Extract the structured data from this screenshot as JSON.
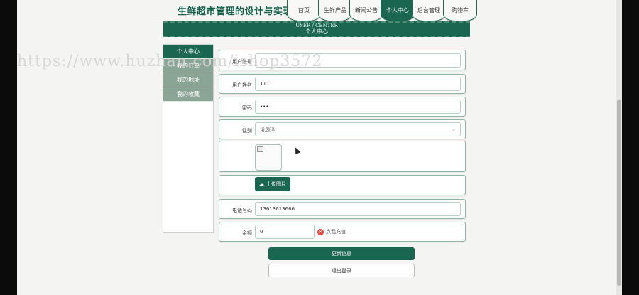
{
  "site_title": "生鲜超市管理的设计与实现",
  "nav": {
    "tabs": [
      {
        "label": "首页",
        "active": false
      },
      {
        "label": "生鲜产品",
        "active": false
      },
      {
        "label": "新闻公告",
        "active": false
      },
      {
        "label": "个人中心",
        "active": true
      },
      {
        "label": "后台管理",
        "active": false
      },
      {
        "label": "购物车",
        "active": false
      }
    ]
  },
  "banner": {
    "en": "USER / CENTER",
    "cn": "个人中心"
  },
  "sidebar": {
    "items": [
      {
        "label": "个人中心",
        "active": true
      },
      {
        "label": "我的订单",
        "active": false
      },
      {
        "label": "我的地址",
        "active": false
      },
      {
        "label": "我的收藏",
        "active": false
      }
    ]
  },
  "form": {
    "username": {
      "label": "用户账号",
      "value": ""
    },
    "name": {
      "label": "用户姓名",
      "value": "111"
    },
    "password": {
      "label": "密码",
      "value": "•••"
    },
    "gender": {
      "label": "性别",
      "placeholder": "请选择"
    },
    "upload": {
      "label": "上传图片"
    },
    "phone": {
      "label": "电话号码",
      "value": "13613613666"
    },
    "balance": {
      "label": "余额",
      "value": "0",
      "hint": "点我充值"
    }
  },
  "buttons": {
    "update": "更新信息",
    "logout": "退出登录"
  },
  "watermark": "https://www.huzhan.com/ishop3572",
  "colors": {
    "accent": "#1b6650",
    "accent_light": "#8aa596",
    "background": "#f4f4f2"
  }
}
